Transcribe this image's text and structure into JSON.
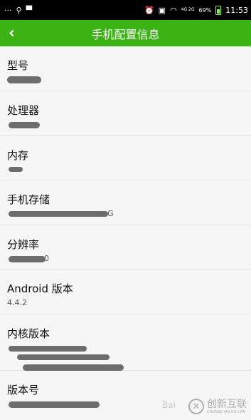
{
  "status_bar": {
    "left_icons": [
      "more-icon",
      "usb-icon",
      "android-icon"
    ],
    "right_icons": [
      "alarm-icon",
      "sim-icon",
      "wifi-icon",
      "signal-icon"
    ],
    "signal_text": "4G 2G",
    "battery_percent": "69%",
    "time": "11:53"
  },
  "app_bar": {
    "back_glyph": "‹",
    "title": "手机配置信息"
  },
  "rows": [
    {
      "label": "型号",
      "value": ""
    },
    {
      "label": "处理器",
      "value": ""
    },
    {
      "label": "内存",
      "value": ""
    },
    {
      "label": "手机存储",
      "value": "G"
    },
    {
      "label": "分辨率",
      "value": "0"
    },
    {
      "label": "Android 版本",
      "value": "4.4.2"
    },
    {
      "label": "内核版本",
      "value": ""
    },
    {
      "label": "版本号",
      "value": ""
    }
  ],
  "watermark": {
    "icon_glyph": "✕",
    "text": "创新互联",
    "sub": "CHUANG XIN HU LIAN"
  },
  "colors": {
    "accent": "#3bb313",
    "status_bg": "#000000"
  }
}
